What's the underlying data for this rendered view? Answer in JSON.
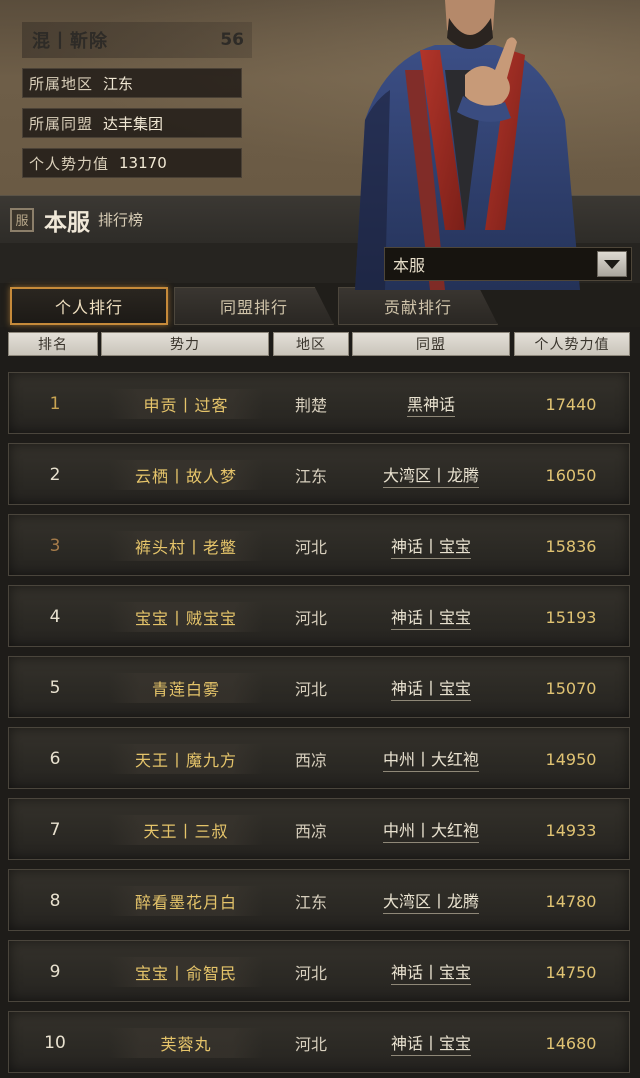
{
  "profile": {
    "name": "混丨靳除",
    "level": "56",
    "region_label": "所属地区",
    "region_value": "江东",
    "alliance_label": "所属同盟",
    "alliance_value": "达丰集团",
    "power_label": "个人势力值",
    "power_value": "13170"
  },
  "title": {
    "seal": "服",
    "main": "本服",
    "sub": "排行榜"
  },
  "server_select": {
    "value": "本服"
  },
  "tabs": [
    {
      "label": "个人排行",
      "active": true
    },
    {
      "label": "同盟排行",
      "active": false
    },
    {
      "label": "贡献排行",
      "active": false
    }
  ],
  "columns": {
    "rank": "排名",
    "power": "势力",
    "region": "地区",
    "alliance": "同盟",
    "score": "个人势力值"
  },
  "rows": [
    {
      "rank": "1",
      "name": "申贡丨过客",
      "region": "荆楚",
      "alliance": "黑神话",
      "score": "17440"
    },
    {
      "rank": "2",
      "name": "云栖丨故人梦",
      "region": "江东",
      "alliance": "大湾区丨龙腾",
      "score": "16050"
    },
    {
      "rank": "3",
      "name": "裤头村丨老鳖",
      "region": "河北",
      "alliance": "神话丨宝宝",
      "score": "15836"
    },
    {
      "rank": "4",
      "name": "宝宝丨贼宝宝",
      "region": "河北",
      "alliance": "神话丨宝宝",
      "score": "15193"
    },
    {
      "rank": "5",
      "name": "青莲白雾",
      "region": "河北",
      "alliance": "神话丨宝宝",
      "score": "15070"
    },
    {
      "rank": "6",
      "name": "天王丨魔九方",
      "region": "西凉",
      "alliance": "中州丨大红袍",
      "score": "14950"
    },
    {
      "rank": "7",
      "name": "天王丨三叔",
      "region": "西凉",
      "alliance": "中州丨大红袍",
      "score": "14933"
    },
    {
      "rank": "8",
      "name": "醉看墨花月白",
      "region": "江东",
      "alliance": "大湾区丨龙腾",
      "score": "14780"
    },
    {
      "rank": "9",
      "name": "宝宝丨俞智民",
      "region": "河北",
      "alliance": "神话丨宝宝",
      "score": "14750"
    },
    {
      "rank": "10",
      "name": "芙蓉丸",
      "region": "河北",
      "alliance": "神话丨宝宝",
      "score": "14680"
    }
  ],
  "colors": {
    "accent_tab_border": "#c68a3a",
    "name_gold": "#e5c46a",
    "score_gold": "#e0c373"
  }
}
